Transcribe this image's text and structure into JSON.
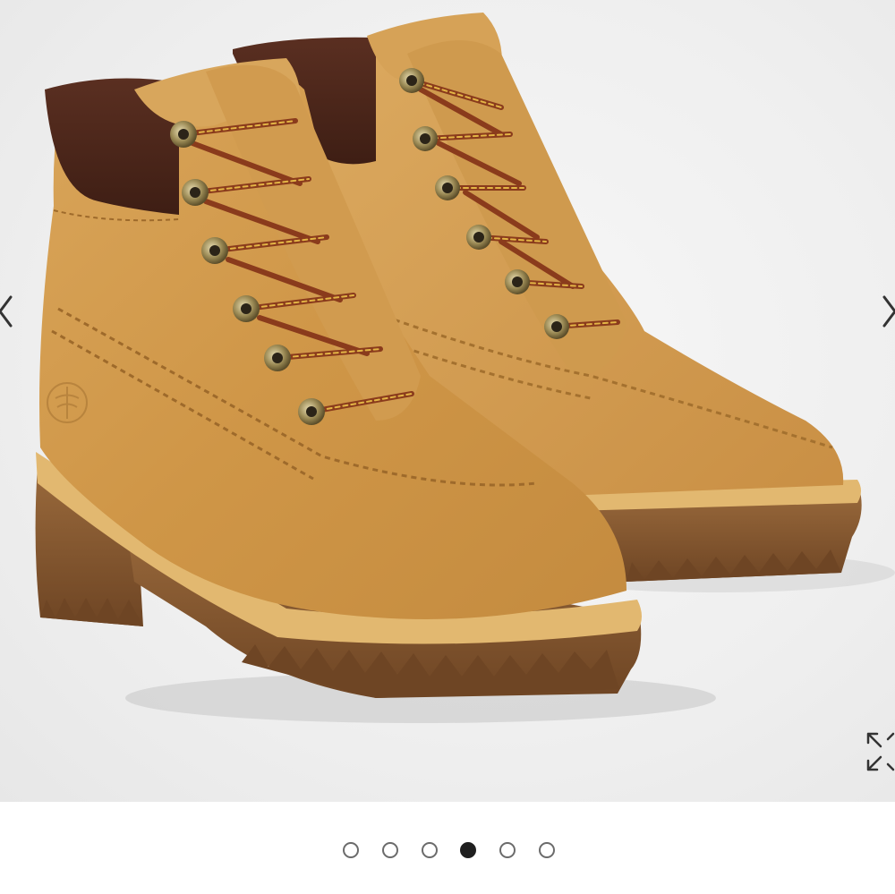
{
  "gallery": {
    "image_alt": "",
    "active_index": 3,
    "slide_count": 6,
    "dots": [
      {
        "state": "inactive"
      },
      {
        "state": "inactive"
      },
      {
        "state": "inactive"
      },
      {
        "state": "active"
      },
      {
        "state": "inactive"
      },
      {
        "state": "inactive"
      }
    ],
    "icons": {
      "prev": "chevron-left-icon",
      "next": "chevron-right-icon",
      "expand": "expand-icon"
    }
  },
  "colors": {
    "background": "#ffffff",
    "dot_active": "#1f1f1f",
    "dot_border": "#6b6b6b"
  }
}
